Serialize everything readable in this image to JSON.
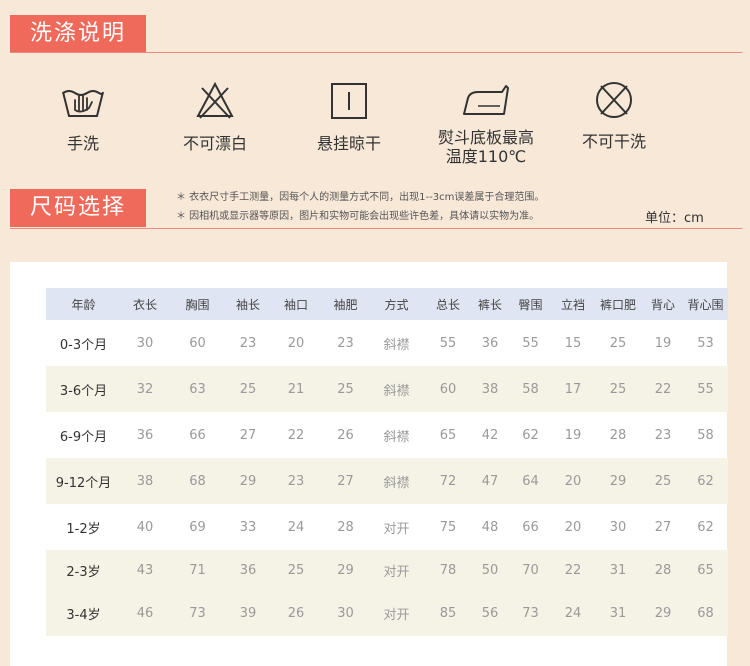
{
  "care_section": {
    "title": "洗涤说明",
    "items": [
      {
        "icon": "hand-wash-icon",
        "label": "手洗"
      },
      {
        "icon": "no-bleach-icon",
        "label": "不可漂白"
      },
      {
        "icon": "hang-dry-icon",
        "label": "悬挂晾干"
      },
      {
        "icon": "iron-icon",
        "label": "熨斗底板最高",
        "label2": "温度110℃"
      },
      {
        "icon": "no-dry-clean-icon",
        "label": "不可干洗"
      }
    ]
  },
  "size_section": {
    "title": "尺码选择",
    "notes": [
      "＊ 衣衣尺寸手工测量，因每个人的测量方式不同，出现1--3cm误差属于合理范围。",
      "＊ 因相机或显示器等原因，图片和实物可能会出现些许色差，具体请以实物为准。"
    ],
    "unit": "单位：cm"
  },
  "table": {
    "headers": [
      "年龄",
      "衣长",
      "胸围",
      "袖长",
      "袖口",
      "袖肥",
      "方式",
      "总长",
      "裤长",
      "臀围",
      "立裆",
      "裤口肥",
      "背心",
      "背心围"
    ],
    "rows": [
      [
        "0-3个月",
        "30",
        "60",
        "23",
        "20",
        "23",
        "斜襟",
        "55",
        "36",
        "55",
        "15",
        "25",
        "19",
        "53"
      ],
      [
        "3-6个月",
        "32",
        "63",
        "25",
        "21",
        "25",
        "斜襟",
        "60",
        "38",
        "58",
        "17",
        "25",
        "22",
        "55"
      ],
      [
        "6-9个月",
        "36",
        "66",
        "27",
        "22",
        "26",
        "斜襟",
        "65",
        "42",
        "62",
        "19",
        "28",
        "23",
        "58"
      ],
      [
        "9-12个月",
        "38",
        "68",
        "29",
        "23",
        "27",
        "斜襟",
        "72",
        "47",
        "64",
        "20",
        "29",
        "25",
        "62"
      ],
      [
        "1-2岁",
        "40",
        "69",
        "33",
        "24",
        "28",
        "对开",
        "75",
        "48",
        "66",
        "20",
        "30",
        "27",
        "62"
      ],
      [
        "2-3岁",
        "43",
        "71",
        "36",
        "25",
        "29",
        "对开",
        "78",
        "50",
        "70",
        "22",
        "31",
        "28",
        "65"
      ],
      [
        "3-4岁",
        "46",
        "73",
        "39",
        "26",
        "30",
        "对开",
        "85",
        "56",
        "73",
        "24",
        "31",
        "29",
        "68"
      ]
    ]
  }
}
